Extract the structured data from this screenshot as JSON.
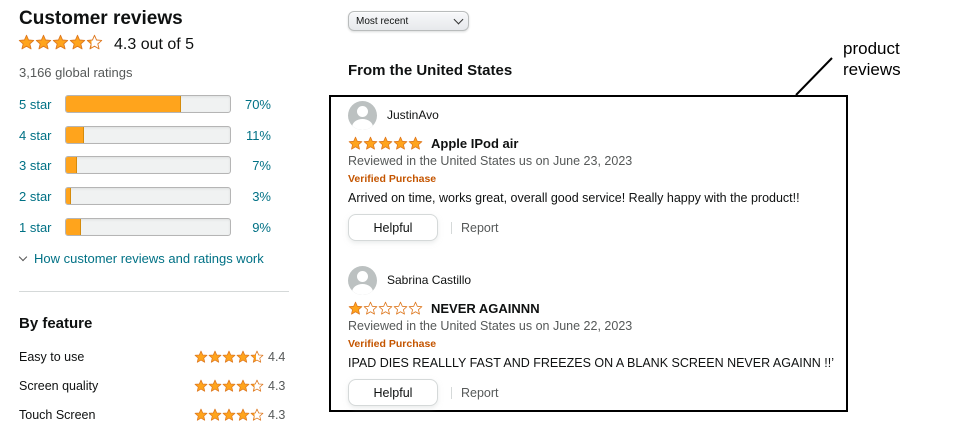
{
  "reviews_summary": {
    "title": "Customer reviews",
    "overall_rating": 4.3,
    "overall_text": "4.3 out of 5",
    "global_ratings": "3,166 global ratings",
    "star_color": "#ffa41c",
    "histogram": [
      {
        "label": "5 star",
        "percent_text": "70%",
        "fraction": 0.7
      },
      {
        "label": "4 star",
        "percent_text": "11%",
        "fraction": 0.11
      },
      {
        "label": "3 star",
        "percent_text": "7%",
        "fraction": 0.07
      },
      {
        "label": "2 star",
        "percent_text": "3%",
        "fraction": 0.03
      },
      {
        "label": "1 star",
        "percent_text": "9%",
        "fraction": 0.09
      }
    ],
    "how_link": "How customer reviews and ratings work"
  },
  "by_feature": {
    "title": "By feature",
    "features": [
      {
        "name": "Easy to use",
        "rating": 4.4,
        "value": "4.4"
      },
      {
        "name": "Screen quality",
        "rating": 4.3,
        "value": "4.3"
      },
      {
        "name": "Touch Screen",
        "rating": 4.3,
        "value": "4.3"
      }
    ]
  },
  "sort": {
    "selected": "Most recent",
    "icon": "chevron-down-icon"
  },
  "region_heading": "From the United States",
  "annotation": {
    "line1": "product",
    "line2": "reviews"
  },
  "reviews": [
    {
      "author": "JustinAvo",
      "rating": 5,
      "title": "Apple IPod air",
      "date": "Reviewed in the United States us on June 23, 2023",
      "verified": "Verified Purchase",
      "body": "Arrived on time, works great, overall good service! Really happy with the product!!",
      "helpful_label": "Helpful",
      "report_label": "Report"
    },
    {
      "author": "Sabrina Castillo",
      "rating": 1,
      "title": "NEVER AGAINNN",
      "date": "Reviewed in the United States us on June 22, 2023",
      "verified": "Verified Purchase",
      "body": "IPAD DIES REALLLY FAST AND FREEZES ON A BLANK SCREEN NEVER AGAINN !!’",
      "helpful_label": "Helpful",
      "report_label": "Report"
    }
  ]
}
